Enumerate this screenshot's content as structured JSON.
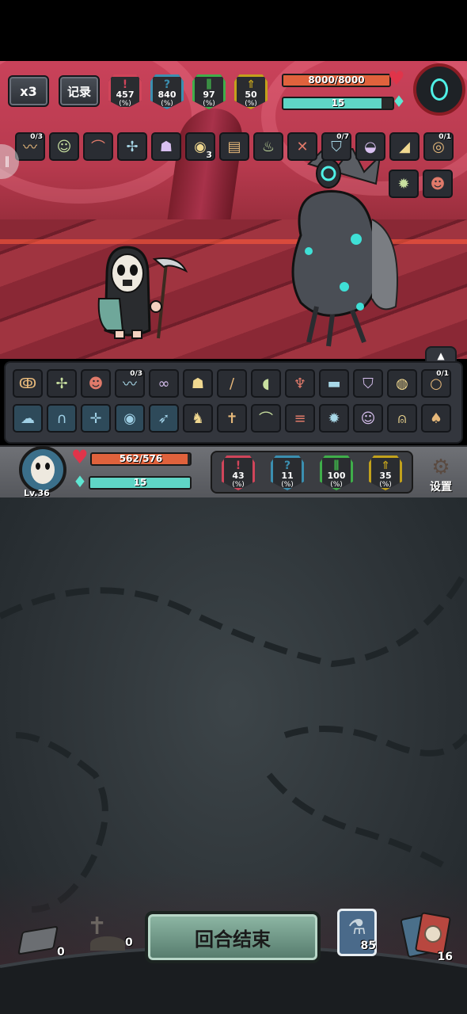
{
  "hud": {
    "speed_label": "x3",
    "log_label": "记录",
    "enemy_stats": [
      {
        "icon": "!",
        "value": "457",
        "unit": "(%)",
        "color": "#d0455a"
      },
      {
        "icon": "?",
        "value": "840",
        "unit": "(%)",
        "color": "#3b8fb0"
      },
      {
        "icon": "⫼",
        "value": "97",
        "unit": "(%)",
        "color": "#3fae4a"
      },
      {
        "icon": "⇑",
        "value": "50",
        "unit": "(%)",
        "color": "#c2a11c"
      }
    ]
  },
  "enemy": {
    "hp_text": "8000/8000",
    "hp_fraction": 1.0,
    "mana_text": "15",
    "mana_fraction": 0.9,
    "hp_color": "#e0623c",
    "mana_color": "#5fd6c6"
  },
  "enemy_items": [
    {
      "icon": "worm-icon",
      "count": "0/3"
    },
    {
      "icon": "doll-icon",
      "count": ""
    },
    {
      "icon": "pepper-icon",
      "count": ""
    },
    {
      "icon": "dragonfly-icon",
      "count": ""
    },
    {
      "icon": "lantern-icon",
      "count": ""
    },
    {
      "icon": "orb-icon",
      "count": "3"
    },
    {
      "icon": "book-icon",
      "count": ""
    },
    {
      "icon": "potion-icon",
      "count": ""
    },
    {
      "icon": "crossbow-icon",
      "count": ""
    },
    {
      "icon": "shield-icon",
      "count": "0/7"
    },
    {
      "icon": "fan-icon",
      "count": ""
    },
    {
      "icon": "wing-icon",
      "count": ""
    },
    {
      "icon": "egg-icon",
      "count": "0/1"
    },
    {
      "icon": "mine-icon",
      "count": ""
    },
    {
      "icon": "owl-icon",
      "count": ""
    }
  ],
  "inventory_row1": [
    {
      "icon": "rope-icon",
      "count": ""
    },
    {
      "icon": "dragonfly-icon",
      "count": ""
    },
    {
      "icon": "owl-icon",
      "count": ""
    },
    {
      "icon": "worm-icon",
      "count": "0/3"
    },
    {
      "icon": "goggles-icon",
      "count": ""
    },
    {
      "icon": "lantern-icon",
      "count": ""
    },
    {
      "icon": "sword-icon",
      "count": ""
    },
    {
      "icon": "meat-icon",
      "count": ""
    },
    {
      "icon": "horn-icon",
      "count": ""
    },
    {
      "icon": "baguette-icon",
      "count": ""
    },
    {
      "icon": "shield-icon",
      "count": ""
    },
    {
      "icon": "bag-icon",
      "count": ""
    },
    {
      "icon": "ring-icon",
      "count": "0/1"
    }
  ],
  "inventory_row2": [
    {
      "icon": "ghost-skill-icon",
      "skill": true
    },
    {
      "icon": "muscle-skill-icon",
      "skill": true
    },
    {
      "icon": "wings-skill-icon",
      "skill": true
    },
    {
      "icon": "eye-skill-icon",
      "skill": true
    },
    {
      "icon": "run-skill-icon",
      "skill": true
    },
    {
      "icon": "beast-icon",
      "skill": false
    },
    {
      "icon": "scarecrow-icon",
      "skill": false
    },
    {
      "icon": "pepper-icon",
      "skill": false
    },
    {
      "icon": "bandage-icon",
      "skill": false
    },
    {
      "icon": "mine-icon",
      "skill": false
    },
    {
      "icon": "doll-icon",
      "skill": false
    },
    {
      "icon": "bell-icon",
      "skill": false
    },
    {
      "icon": "claw-icon",
      "skill": false
    }
  ],
  "player": {
    "level": "Lv.36",
    "hp_text": "562/576",
    "hp_fraction": 0.976,
    "mana_text": "15",
    "mana_fraction": 1.0,
    "stats": [
      {
        "icon": "!",
        "value": "43",
        "unit": "(%)",
        "color": "#d0455a"
      },
      {
        "icon": "?",
        "value": "11",
        "unit": "(%)",
        "color": "#3b8fb0"
      },
      {
        "icon": "⫼",
        "value": "100",
        "unit": "(%)",
        "color": "#3fae4a"
      },
      {
        "icon": "⇑",
        "value": "35",
        "unit": "(%)",
        "color": "#c2a11c"
      }
    ],
    "settings_label": "设置"
  },
  "footer": {
    "discard_count": "0",
    "grave_count": "0",
    "end_turn_label": "回合结束",
    "potion_count": "85",
    "deck_count": "16"
  }
}
